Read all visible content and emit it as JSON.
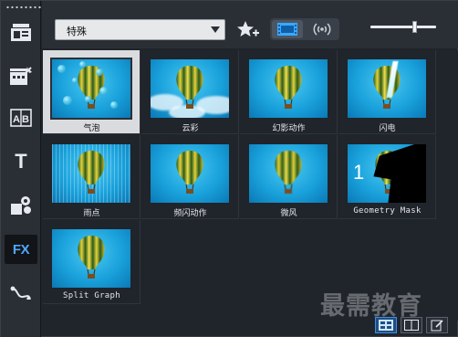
{
  "sidebar": {
    "items": [
      {
        "name": "media",
        "icon": "media-library-icon"
      },
      {
        "name": "instant-project",
        "icon": "instant-project-icon"
      },
      {
        "name": "transition",
        "icon": "transition-icon"
      },
      {
        "name": "title",
        "icon": "title-icon",
        "text": "T"
      },
      {
        "name": "graphics",
        "icon": "graphics-icon"
      },
      {
        "name": "filter",
        "icon": "fx-icon",
        "text": "FX"
      },
      {
        "name": "path",
        "icon": "motion-path-icon"
      }
    ]
  },
  "toolbar": {
    "category_selected": "特殊",
    "add_favorite_icon": "star-plus-icon",
    "view_video_icon": "filmstrip-icon",
    "view_audio_icon": "audio-wave-icon",
    "thumbnail_size_level": 0.45
  },
  "effects": [
    {
      "label": "气泡",
      "selected": true,
      "style": "bubbles"
    },
    {
      "label": "云彩",
      "selected": false,
      "style": "clouds"
    },
    {
      "label": "幻影动作",
      "selected": false,
      "style": "plain"
    },
    {
      "label": "闪电",
      "selected": false,
      "style": "lightning"
    },
    {
      "label": "雨点",
      "selected": false,
      "style": "rain"
    },
    {
      "label": "频闪动作",
      "selected": false,
      "style": "plain"
    },
    {
      "label": "微风",
      "selected": false,
      "style": "wind"
    },
    {
      "label": "Geometry Mask",
      "selected": false,
      "style": "geometry",
      "mono": true
    },
    {
      "label": "Split Graph",
      "selected": false,
      "style": "plain",
      "mono": true
    }
  ],
  "bottom_bar": {
    "icons": [
      "thumbnail-view-icon",
      "list-view-icon",
      "edit-icon"
    ]
  },
  "watermark_text": "最需教育",
  "colors": {
    "accent": "#4fa8ff",
    "selected_cell": "#d9dbde",
    "panel": "#20242b"
  }
}
